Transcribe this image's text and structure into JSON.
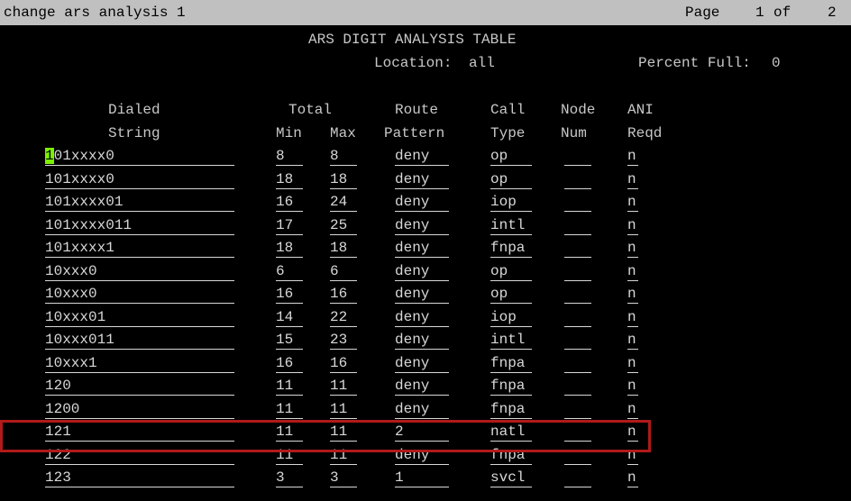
{
  "titlebar": {
    "command": "change ars analysis 1",
    "page_label": "Page",
    "page_current": "1",
    "of_label": "of",
    "page_total": "2"
  },
  "table": {
    "title": "ARS DIGIT ANALYSIS TABLE",
    "location_label": "Location:",
    "location_value": "all",
    "percent_label": "Percent Full:",
    "percent_value": "0"
  },
  "headers": {
    "line1": {
      "dialed": "Dialed",
      "total": "Total",
      "route": "Route",
      "call": "Call",
      "node": "Node",
      "ani": "ANI"
    },
    "line2": {
      "string": "String",
      "min": "Min",
      "max": "Max",
      "pattern": "Pattern",
      "type": "Type",
      "num": "Num",
      "reqd": "Reqd"
    }
  },
  "rows": [
    {
      "dialed": "101xxxx0",
      "min": "8",
      "max": "8",
      "route": "deny",
      "call": "op",
      "node": "",
      "ani": "n"
    },
    {
      "dialed": "101xxxx0",
      "min": "18",
      "max": "18",
      "route": "deny",
      "call": "op",
      "node": "",
      "ani": "n"
    },
    {
      "dialed": "101xxxx01",
      "min": "16",
      "max": "24",
      "route": "deny",
      "call": "iop",
      "node": "",
      "ani": "n"
    },
    {
      "dialed": "101xxxx011",
      "min": "17",
      "max": "25",
      "route": "deny",
      "call": "intl",
      "node": "",
      "ani": "n"
    },
    {
      "dialed": "101xxxx1",
      "min": "18",
      "max": "18",
      "route": "deny",
      "call": "fnpa",
      "node": "",
      "ani": "n"
    },
    {
      "dialed": "10xxx0",
      "min": "6",
      "max": "6",
      "route": "deny",
      "call": "op",
      "node": "",
      "ani": "n"
    },
    {
      "dialed": "10xxx0",
      "min": "16",
      "max": "16",
      "route": "deny",
      "call": "op",
      "node": "",
      "ani": "n"
    },
    {
      "dialed": "10xxx01",
      "min": "14",
      "max": "22",
      "route": "deny",
      "call": "iop",
      "node": "",
      "ani": "n"
    },
    {
      "dialed": "10xxx011",
      "min": "15",
      "max": "23",
      "route": "deny",
      "call": "intl",
      "node": "",
      "ani": "n"
    },
    {
      "dialed": "10xxx1",
      "min": "16",
      "max": "16",
      "route": "deny",
      "call": "fnpa",
      "node": "",
      "ani": "n"
    },
    {
      "dialed": "120",
      "min": "11",
      "max": "11",
      "route": "deny",
      "call": "fnpa",
      "node": "",
      "ani": "n"
    },
    {
      "dialed": "1200",
      "min": "11",
      "max": "11",
      "route": "deny",
      "call": "fnpa",
      "node": "",
      "ani": "n"
    },
    {
      "dialed": "121",
      "min": "11",
      "max": "11",
      "route": "2",
      "call": "natl",
      "node": "",
      "ani": "n"
    },
    {
      "dialed": "122",
      "min": "11",
      "max": "11",
      "route": "deny",
      "call": "fnpa",
      "node": "",
      "ani": "n"
    },
    {
      "dialed": "123",
      "min": "3",
      "max": "3",
      "route": "1",
      "call": "svcl",
      "node": "",
      "ani": "n"
    }
  ],
  "cursor_char": "1",
  "highlight_color": "#b01a1a",
  "cursor_color": "#7cf000"
}
